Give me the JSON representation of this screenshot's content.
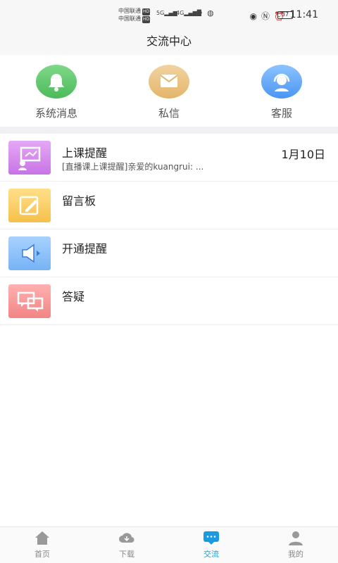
{
  "status_bar": {
    "carrier_1": "中国联通",
    "carrier_2": "中国联通",
    "hd": "HD",
    "sig_label": "5G",
    "sig_label_2": "4G",
    "battery": "37",
    "time": "11:41"
  },
  "header": {
    "title": "交流中心"
  },
  "quick_entries": [
    {
      "label": "系统消息",
      "icon": "bell-icon"
    },
    {
      "label": "私信",
      "icon": "envelope-icon"
    },
    {
      "label": "客服",
      "icon": "headset-icon"
    }
  ],
  "list": [
    {
      "title": "上课提醒",
      "date": "1月10日",
      "preview": "[直播课上课提醒]亲爱的kuangrui: ...",
      "icon": "presentation-icon"
    },
    {
      "title": "留言板",
      "date": "",
      "preview": "",
      "icon": "note-pen-icon"
    },
    {
      "title": "开通提醒",
      "date": "",
      "preview": "",
      "icon": "speaker-icon"
    },
    {
      "title": "答疑",
      "date": "",
      "preview": "",
      "icon": "chat-bubbles-icon"
    }
  ],
  "bottom_nav": [
    {
      "label": "首页",
      "icon": "home-icon"
    },
    {
      "label": "下载",
      "icon": "cloud-download-icon"
    },
    {
      "label": "交流",
      "icon": "chat-icon",
      "active": true
    },
    {
      "label": "我的",
      "icon": "user-icon"
    }
  ],
  "colors": {
    "accent": "#1a9be0"
  }
}
